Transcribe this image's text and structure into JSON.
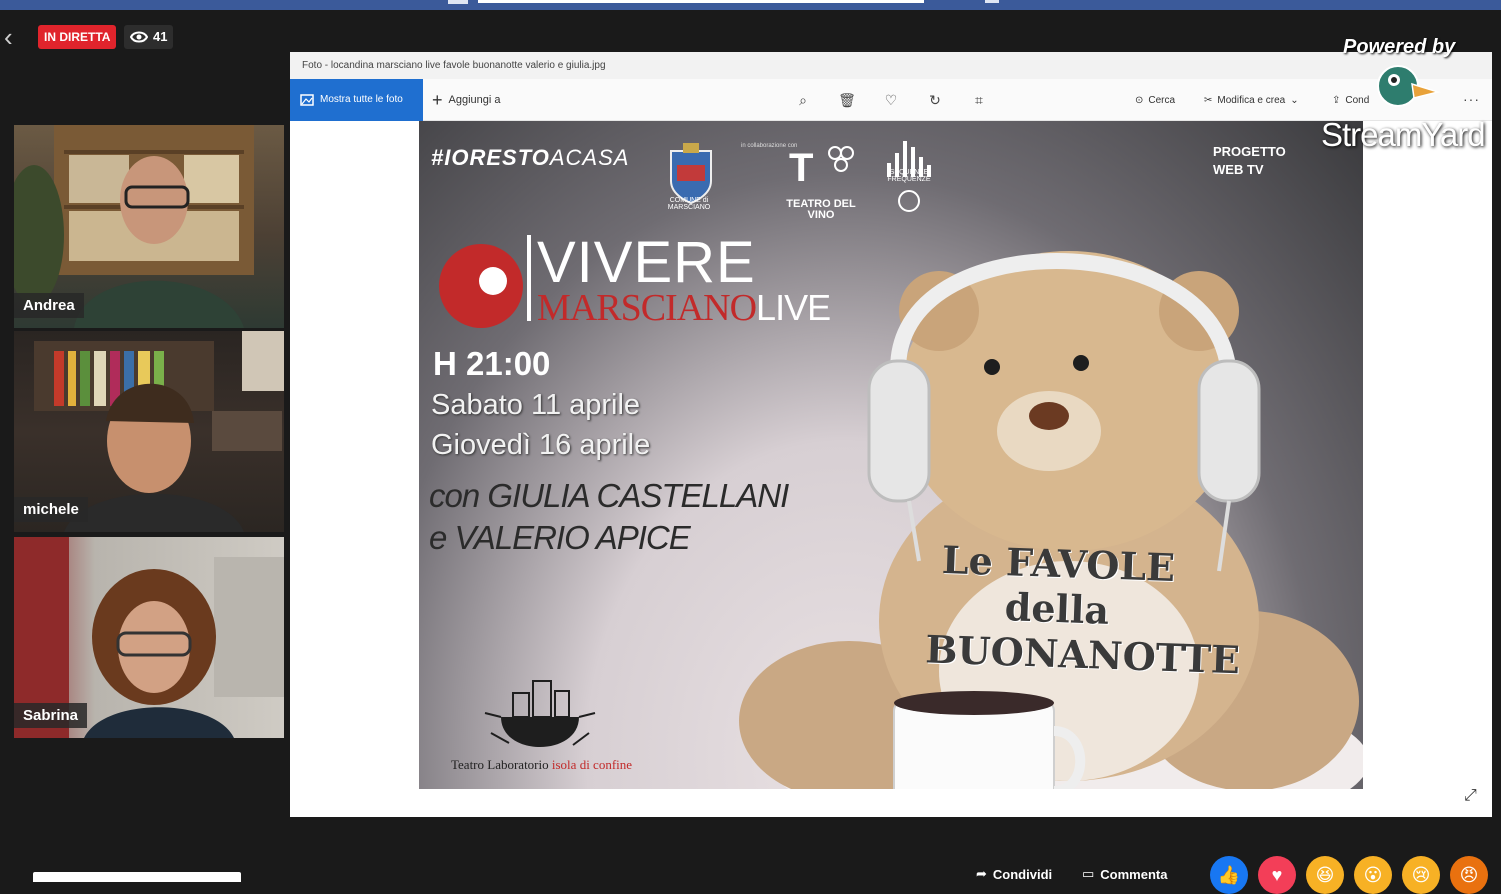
{
  "stream": {
    "live_label": "IN DIRETTA",
    "viewer_count": "41"
  },
  "participants": [
    {
      "name": "Andrea"
    },
    {
      "name": "michele"
    },
    {
      "name": "Sabrina"
    }
  ],
  "photo_window": {
    "title": "Foto - locandina marsciano live favole buonanotte valerio e giulia.jpg",
    "toolbar": {
      "show_all": "Mostra tutte le foto",
      "add_to": "Aggiungi a",
      "search": "Cerca",
      "edit_create": "Modifica e crea",
      "share": "Cond"
    }
  },
  "poster": {
    "hashtag_bold": "#IORESTO",
    "hashtag_rest": "ACASA",
    "collab": "in collaborazione con",
    "comune_label": "COMUNE di MARSCIANO",
    "teatro_label": "TEATRO DEL VINO",
    "sequenze_label": "SEQUENZE FREQUENZE",
    "webtv_line1": "PROGETTO",
    "webtv_line2": "WEB TV",
    "brand_top": "VIVERE",
    "brand_bottom": "MARSCIANO",
    "brand_live": "LIVE",
    "time": "H 21:00",
    "date1": "Sabato 11 aprile",
    "date2": "Giovedì 16 aprile",
    "cast1": "con GIULIA CASTELLANI",
    "cast2": "e VALERIO APICE",
    "favole_line1": "Le FAVOLE",
    "favole_line2": "della",
    "favole_line3": "BUONANOTTE",
    "isola_left": "Teatro Laboratorio",
    "isola_right": "isola di confine"
  },
  "overlay": {
    "powered_by": "Powered by",
    "brand": "StreamYard"
  },
  "footer": {
    "share": "Condividi",
    "comment": "Commenta"
  },
  "colors": {
    "live_red": "#e0242c",
    "photos_blue": "#1f6fd0",
    "fb_blue": "#3b5a9a"
  }
}
